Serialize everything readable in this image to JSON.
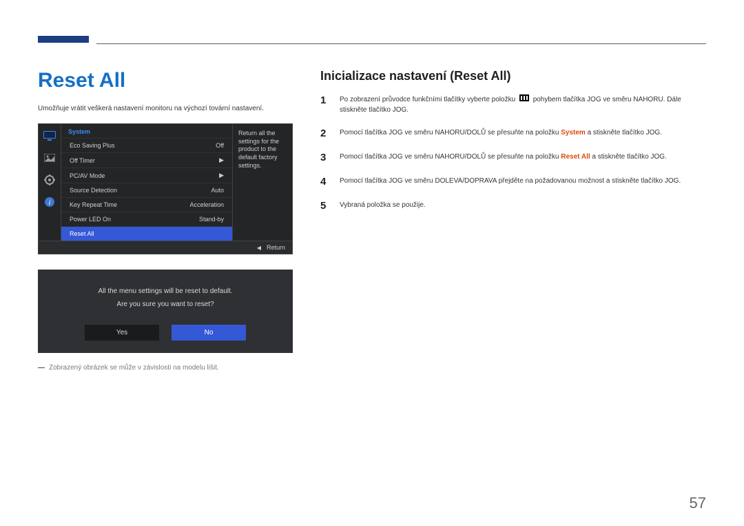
{
  "page_number": "57",
  "left": {
    "title": "Reset All",
    "subtitle": "Umožňuje vrátit veškerá nastavení monitoru na výchozí tovární nastavení.",
    "osd": {
      "section_title": "System",
      "rows": [
        {
          "label": "Eco Saving Plus",
          "value": "Off"
        },
        {
          "label": "Off Timer",
          "value": "▶"
        },
        {
          "label": "PC/AV Mode",
          "value": "▶"
        },
        {
          "label": "Source Detection",
          "value": "Auto"
        },
        {
          "label": "Key Repeat Time",
          "value": "Acceleration"
        },
        {
          "label": "Power LED On",
          "value": "Stand-by"
        },
        {
          "label": "Reset All",
          "value": ""
        }
      ],
      "description": "Return all the settings for the product to the default factory settings.",
      "footer_return": "Return"
    },
    "dialog": {
      "line1": "All the menu settings will be reset to default.",
      "line2": "Are you sure you want to reset?",
      "yes": "Yes",
      "no": "No"
    },
    "footnote": "Zobrazený obrázek se může v závislosti na modelu lišit."
  },
  "right": {
    "title": "Inicializace nastavení (Reset All)",
    "steps": {
      "s1_a": "Po zobrazení průvodce funkčními tlačítky vyberte položku ",
      "s1_b": " pohybem tlačítka JOG ve směru NAHORU. Dále stiskněte tlačítko JOG.",
      "s2_a": "Pomocí tlačítka JOG ve směru NAHORU/DOLŮ se přesuňte na položku ",
      "s2_hl": "System",
      "s2_b": " a stiskněte tlačítko JOG.",
      "s3_a": "Pomocí tlačítka JOG ve směru NAHORU/DOLŮ se přesuňte na položku ",
      "s3_hl": "Reset All",
      "s3_b": " a stiskněte tlačítko JOG.",
      "s4": "Pomocí tlačítka JOG ve směru DOLEVA/DOPRAVA přejděte na požadovanou možnost a stiskněte tlačítko JOG.",
      "s5": "Vybraná položka se použije."
    }
  }
}
